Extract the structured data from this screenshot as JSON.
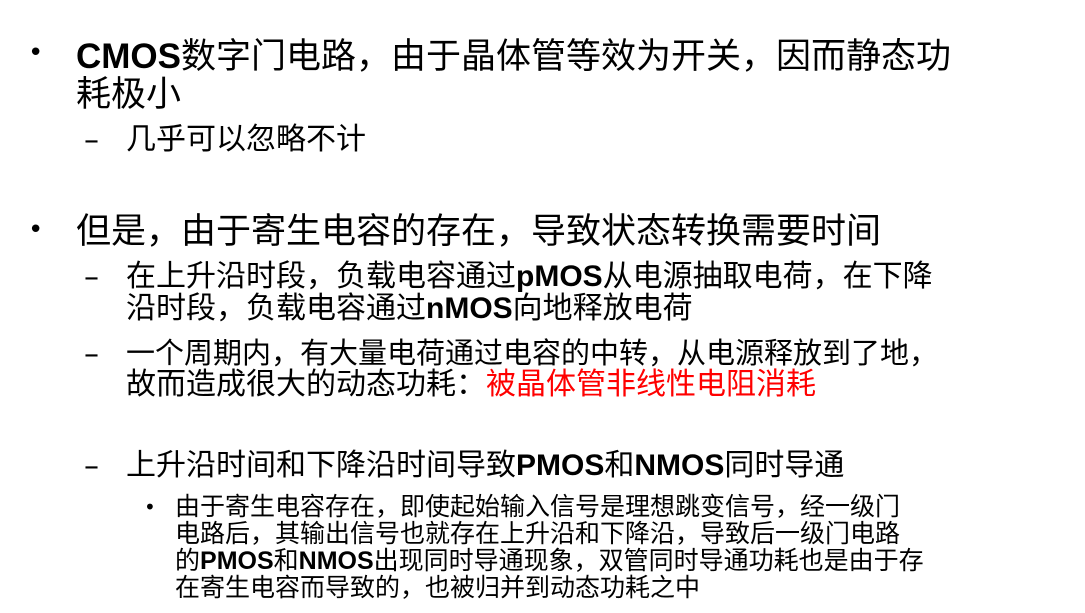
{
  "bullets": [
    {
      "text_parts": [
        "CMOS",
        "数字门电路，由于晶体管等效为开关，因而静态功",
        "耗极小"
      ],
      "children": [
        {
          "text": "几乎可以忽略不计"
        }
      ]
    },
    {
      "text": "但是，由于寄生电容的存在，导致状态转换需要时间",
      "children": [
        {
          "line1_parts": [
            "在上升沿时段，负载电容通过",
            "pMOS",
            "从电源抽取电荷，在下降"
          ],
          "line2_parts": [
            "沿时段，负载电容通过",
            "nMOS",
            "向地释放电荷"
          ]
        },
        {
          "line1": "一个周期内，有大量电荷通过电容的中转，从电源释放到了地，",
          "line2_black": "故而造成很大的动态功耗：",
          "line2_red": "被晶体管非线性电阻消耗"
        },
        {
          "parts": [
            "上升沿时间和下降沿时间导致",
            "PMOS",
            "和",
            "NMOS",
            "同时导通"
          ],
          "children": [
            {
              "lines": [
                [
                  "由于寄生电容存在，即使起始输入信号是理想跳变信号，经一级门"
                ],
                [
                  "电路后，其输出信号也就存在上升沿和下降沿，导致后一级门电路"
                ],
                [
                  "的",
                  "PMOS",
                  "和",
                  "NMOS",
                  "出现同时导通现象，双管同时导通功耗也是由于存"
                ],
                [
                  "在寄生电容而导致的，也被归并到动态功耗之中"
                ]
              ]
            }
          ]
        }
      ]
    }
  ],
  "glyphs": {
    "bullet": "•",
    "dash": "–"
  },
  "colors": {
    "text": "#000000",
    "highlight": "#ff0000",
    "background": "#ffffff"
  }
}
